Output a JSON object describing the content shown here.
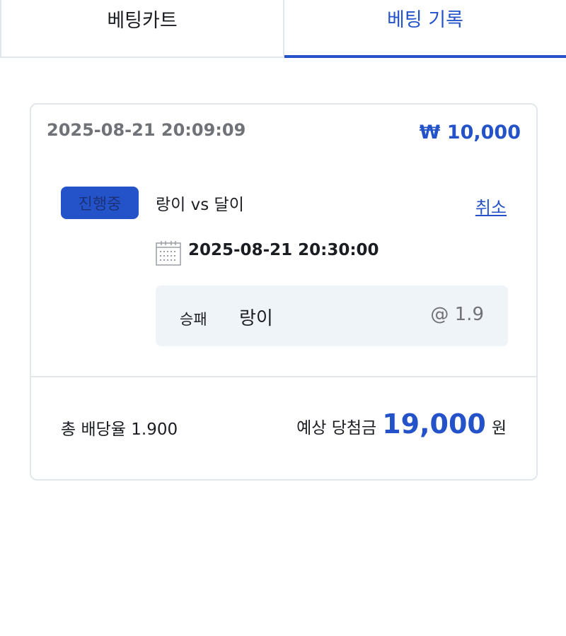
{
  "tabs": [
    {
      "label": "베팅카트",
      "active": false
    },
    {
      "label": "베팅 기록",
      "active": true
    }
  ],
  "bet": {
    "placed_at": "2025-08-21 20:09:09",
    "stake": "₩ 10,000",
    "status": "진행중",
    "match": "랑이 vs 달이",
    "cancel_label": "취소",
    "match_time": "2025-08-21 20:30:00",
    "pick": {
      "market": "승패",
      "selection": "랑이",
      "odds": "@ 1.9"
    },
    "total_odds": "총 배당율 1.900",
    "payout_label": "예상 당첨금",
    "payout_amount": "19,000",
    "payout_unit": "원"
  },
  "colors": {
    "accent": "#2453c9",
    "muted_text": "#707277",
    "border": "#e3e7ec",
    "pick_bg": "#eff4f9"
  },
  "icons": {
    "calendar": "calendar-icon"
  }
}
